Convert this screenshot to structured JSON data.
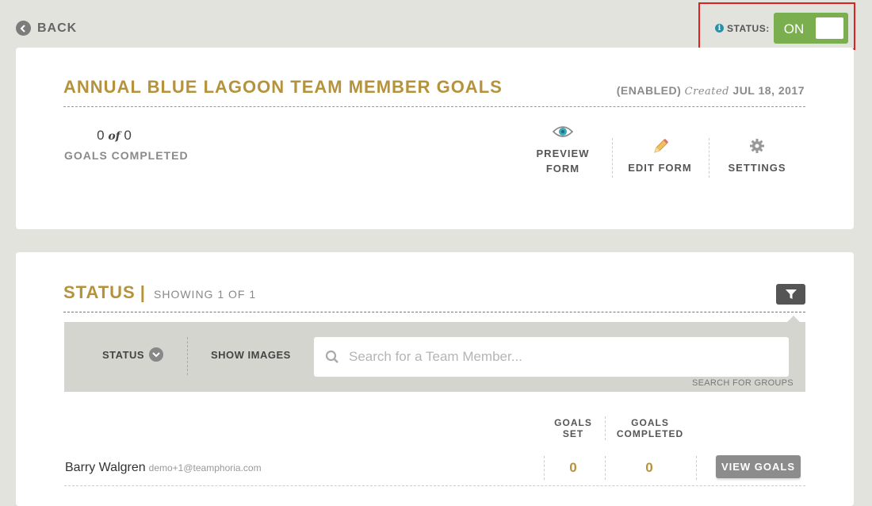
{
  "header": {
    "back_label": "BACK",
    "status_label": "STATUS:",
    "toggle_label": "ON",
    "info_icon_glyph": "i"
  },
  "form": {
    "title": "ANNUAL BLUE LAGOON TEAM MEMBER GOALS",
    "enabled": "(ENABLED)",
    "created_word": "Created",
    "created_date": "JUL 18, 2017",
    "completed_count": "0",
    "of_word": "of",
    "total_count": "0",
    "goals_completed_label": "GOALS COMPLETED"
  },
  "actions": {
    "preview_line1": "PREVIEW",
    "preview_line2": "FORM",
    "edit_label": "EDIT FORM",
    "settings_label": "SETTINGS"
  },
  "status_section": {
    "title": "STATUS",
    "separator": "|",
    "showing": "SHOWING 1 OF 1"
  },
  "filters": {
    "status_label": "STATUS",
    "show_images_label": "SHOW IMAGES",
    "search_placeholder": "Search for a Team Member...",
    "search_groups_label": "SEARCH FOR GROUPS"
  },
  "table": {
    "col_goals_set_line1": "GOALS",
    "col_goals_set_line2": "SET",
    "col_goals_completed_line1": "GOALS",
    "col_goals_completed_line2": "COMPLETED",
    "rows": [
      {
        "name": "Barry Walgren",
        "email": "demo+1@teamphoria.com",
        "goals_set": "0",
        "goals_completed": "0",
        "button": "VIEW GOALS"
      }
    ]
  },
  "colors": {
    "accent_gold": "#b5923c",
    "toggle_green": "#7aae4e",
    "highlight_red": "#e02020",
    "background": "#e3e3de"
  }
}
